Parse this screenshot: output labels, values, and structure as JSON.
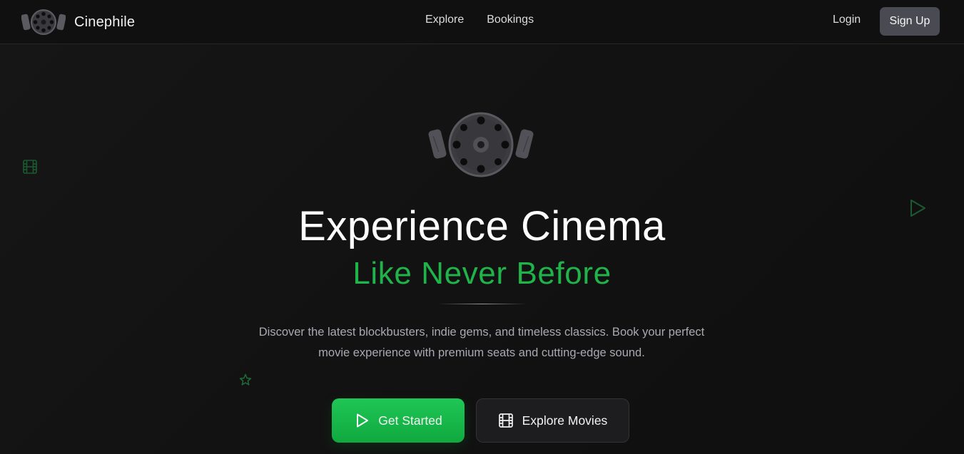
{
  "app": {
    "name": "Cinephile",
    "logo_icon": "film-reel-icon"
  },
  "nav": {
    "links": [
      {
        "label": "Explore"
      },
      {
        "label": "Bookings"
      }
    ],
    "login_label": "Login",
    "signup_label": "Sign Up"
  },
  "hero": {
    "logo_icon": "film-reel-icon",
    "title": "Experience Cinema",
    "subtitle": "Like Never Before",
    "description": "Discover the latest blockbusters, indie gems, and timeless classics. Book your perfect movie experience with premium seats and cutting-edge sound.",
    "primary_button": {
      "label": "Get Started",
      "icon": "play-icon"
    },
    "secondary_button": {
      "label": "Explore Movies",
      "icon": "film-icon"
    }
  },
  "decorations": [
    "film-icon",
    "play-icon",
    "star-icon"
  ],
  "colors": {
    "accent": "#1fb34a",
    "background": "#141414",
    "signup_bg": "#4a4a52",
    "primary_button": "#16b84b"
  }
}
